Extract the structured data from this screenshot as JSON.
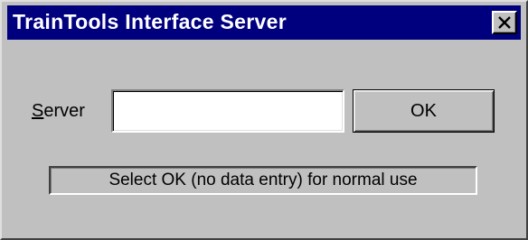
{
  "window": {
    "title": "TrainTools Interface Server",
    "close_icon": "close-icon"
  },
  "form": {
    "server_label_mnemonic": "S",
    "server_label_rest": "erver",
    "server_value": "",
    "ok_label": "OK"
  },
  "status": {
    "message": "Select OK (no data entry) for normal use"
  },
  "colors": {
    "titlebar": "#00007f",
    "face": "#c0c0c0",
    "title_text": "#ffffff"
  }
}
